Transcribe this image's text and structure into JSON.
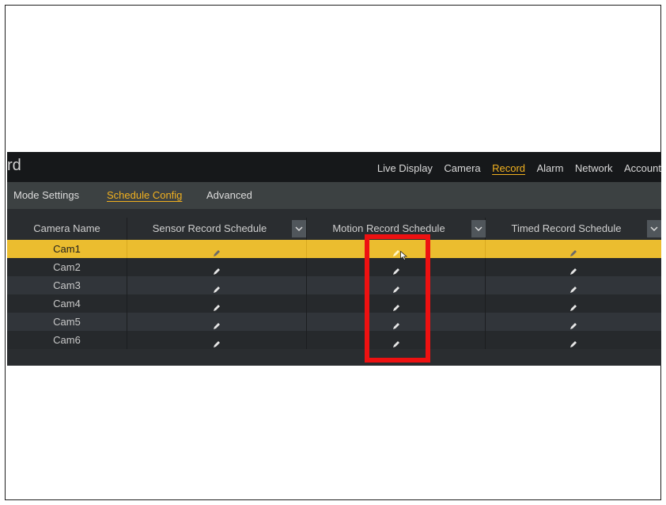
{
  "app": {
    "title": "rd"
  },
  "top_nav": [
    {
      "label": "Live Display",
      "active": false
    },
    {
      "label": "Camera",
      "active": false
    },
    {
      "label": "Record",
      "active": true
    },
    {
      "label": "Alarm",
      "active": false
    },
    {
      "label": "Network",
      "active": false
    },
    {
      "label": "Account",
      "active": false
    }
  ],
  "sub_tabs": [
    {
      "label": "Mode Settings",
      "active": false
    },
    {
      "label": "Schedule Config",
      "active": true
    },
    {
      "label": "Advanced",
      "active": false
    }
  ],
  "table": {
    "headers": [
      "Camera Name",
      "Sensor Record Schedule",
      "Motion Record Schedule",
      "Timed Record Schedule"
    ],
    "rows": [
      {
        "name": "Cam1",
        "selected": true
      },
      {
        "name": "Cam2",
        "selected": false
      },
      {
        "name": "Cam3",
        "selected": false
      },
      {
        "name": "Cam4",
        "selected": false
      },
      {
        "name": "Cam5",
        "selected": false
      },
      {
        "name": "Cam6",
        "selected": false
      }
    ],
    "cell_icon": "pencil-edit-icon",
    "dropdown_icon": "chevron-down-icon"
  },
  "annotation": {
    "type": "highlight-box",
    "color": "#ee1111",
    "target": "Motion Record Schedule column"
  },
  "colors": {
    "accent": "#f0b020",
    "selected_row": "#ebbd2f",
    "topbar_bg": "#16181a",
    "subbar_bg": "#3c4142"
  }
}
